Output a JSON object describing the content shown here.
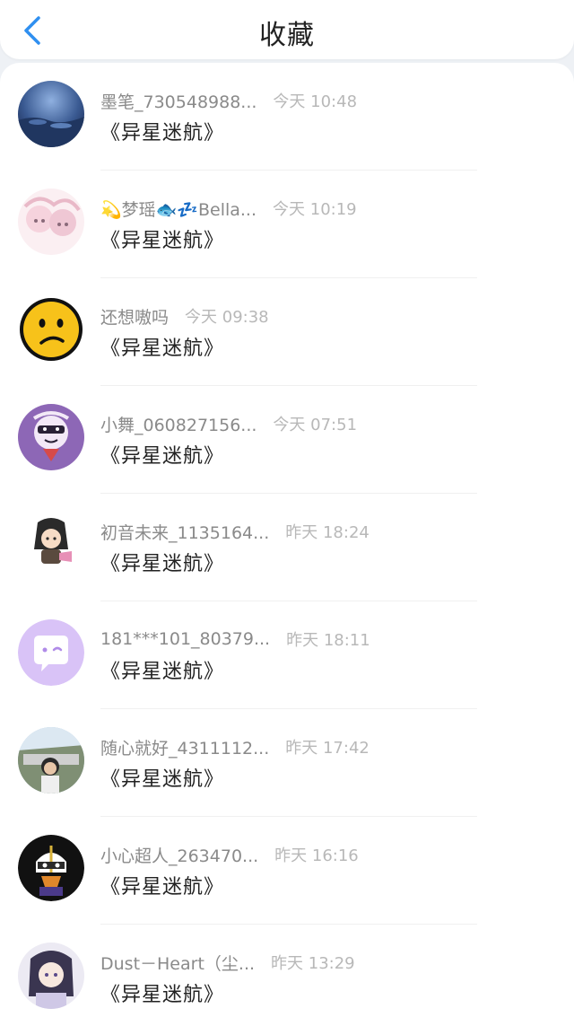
{
  "header": {
    "title": "收藏",
    "back_icon": "chevron-left-icon",
    "accent": "#2f8ff0"
  },
  "items": [
    {
      "name": "墨笔_730548988...",
      "time": "今天 10:48",
      "content": "《异星迷航》",
      "avatar": "landscape"
    },
    {
      "name": "💫梦瑶🐟💤Bella...",
      "time": "今天 10:19",
      "content": "《异星迷航》",
      "avatar": "anime-pink"
    },
    {
      "name": "还想嗷吗",
      "time": "今天 09:38",
      "content": "《异星迷航》",
      "avatar": "emoji-face"
    },
    {
      "name": "小舞_060827156...",
      "time": "今天 07:51",
      "content": "《异星迷航》",
      "avatar": "tiger-cartoon"
    },
    {
      "name": "初音未来_1135164...",
      "time": "昨天 18:24",
      "content": "《异星迷航》",
      "avatar": "anime-sticker"
    },
    {
      "name": "181***101_80379...",
      "time": "昨天 18:11",
      "content": "《异星迷航》",
      "avatar": "chat-bubble"
    },
    {
      "name": "随心就好_4311112...",
      "time": "昨天 17:42",
      "content": "《异星迷航》",
      "avatar": "photo-person"
    },
    {
      "name": "小心超人_263470...",
      "time": "昨天 16:16",
      "content": "《异星迷航》",
      "avatar": "hero-cartoon"
    },
    {
      "name": "Dust－Heart（尘...",
      "time": "昨天 13:29",
      "content": "《异星迷航》",
      "avatar": "anime-girl"
    }
  ]
}
